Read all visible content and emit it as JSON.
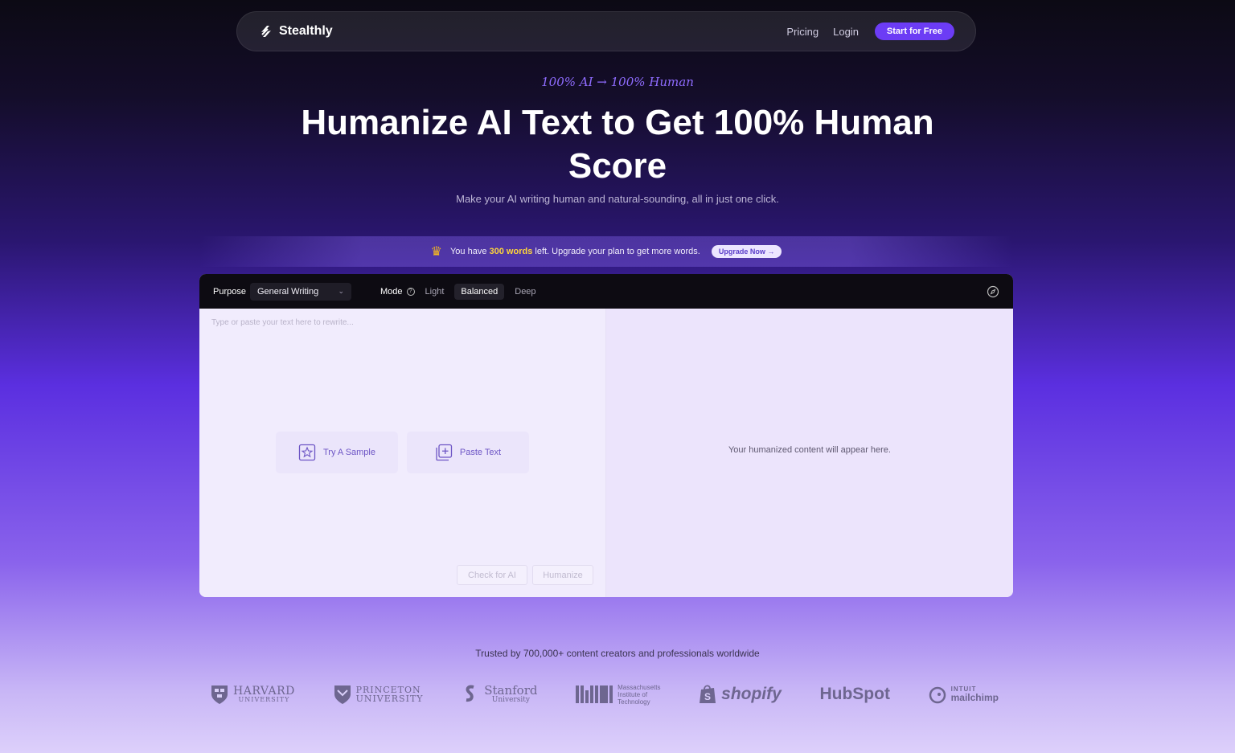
{
  "nav": {
    "brand": "Stealthly",
    "links": [
      "Pricing",
      "Login"
    ],
    "cta": "Start for Free"
  },
  "hero": {
    "tagline": "100% AI → 100% Human",
    "headline": "Humanize AI Text to Get 100% Human Score",
    "subline": "Make your AI writing human and natural-sounding, all in just one click."
  },
  "banner": {
    "prefix": "You have ",
    "words": "300 words",
    "suffix": " left. Upgrade your plan to get more words.",
    "button": "Upgrade Now"
  },
  "editor": {
    "purpose_label": "Purpose",
    "purpose_value": "General Writing",
    "mode_label": "Mode",
    "modes": [
      "Light",
      "Balanced",
      "Deep"
    ],
    "active_mode": "Balanced",
    "input_placeholder": "Type or paste your text here to rewrite...",
    "try_sample": "Try A Sample",
    "paste_text": "Paste Text",
    "check_ai": "Check for AI",
    "humanize": "Humanize",
    "output_placeholder": "Your humanized content will appear here."
  },
  "trusted": {
    "text": "Trusted by 700,000+ content creators and professionals worldwide",
    "logos": {
      "harvard": [
        "HARVARD",
        "UNIVERSITY"
      ],
      "princeton": [
        "PRINCETON",
        "UNIVERSITY"
      ],
      "stanford": [
        "Stanford",
        "University"
      ],
      "mit": [
        "Massachusetts",
        "Institute of",
        "Technology"
      ],
      "shopify": "shopify",
      "hubspot": "HubSpot",
      "mailchimp": [
        "INTUIT",
        "mailchimp"
      ]
    }
  },
  "colors": {
    "accent": "#6c3cf5",
    "highlight": "#ffd63a",
    "tagline": "#8f6cff"
  }
}
